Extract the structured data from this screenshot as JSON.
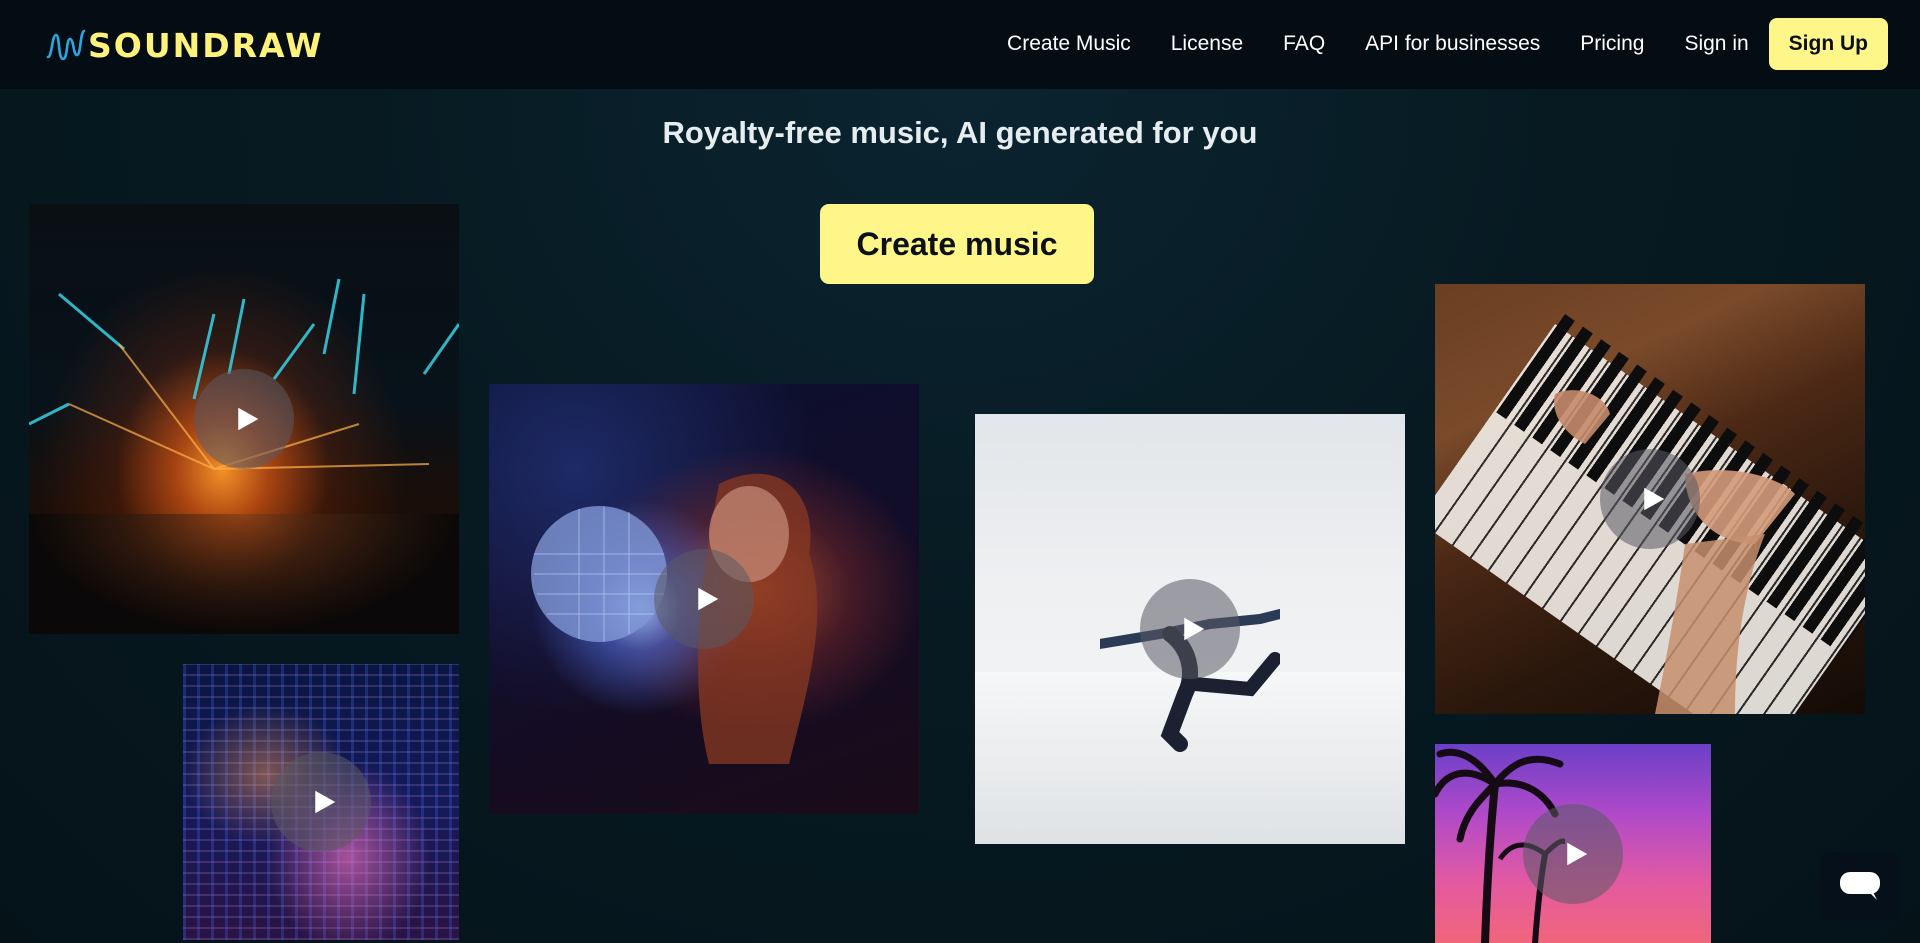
{
  "brand": {
    "name": "SOUNDRAW",
    "accent": "#fff68a",
    "wave_color": "#29a8e0"
  },
  "nav": {
    "items": [
      "Create Music",
      "License",
      "FAQ",
      "API for businesses",
      "Pricing",
      "Sign in"
    ],
    "signup_label": "Sign Up"
  },
  "hero": {
    "tagline": "Royalty-free music, AI generated for you",
    "cta_label": "Create music"
  },
  "tiles": [
    {
      "name": "concert",
      "icon": "play-icon"
    },
    {
      "name": "disco-ball",
      "icon": "play-icon"
    },
    {
      "name": "dancer",
      "icon": "play-icon"
    },
    {
      "name": "piano",
      "icon": "play-icon"
    },
    {
      "name": "city-night",
      "icon": "play-icon"
    },
    {
      "name": "palm-sunset",
      "icon": "play-icon"
    }
  ],
  "chat": {
    "icon": "chat-bubble-icon"
  }
}
